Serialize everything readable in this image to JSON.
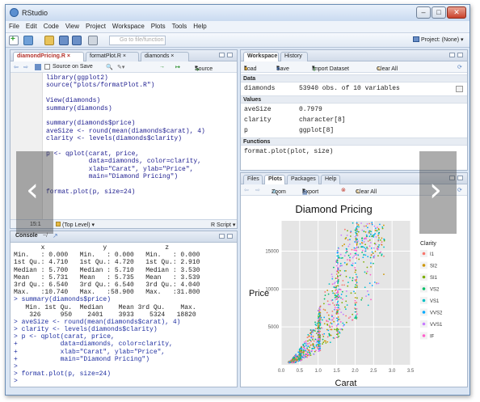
{
  "app": {
    "title": "RStudio"
  },
  "menu": [
    "File",
    "Edit",
    "Code",
    "View",
    "Project",
    "Workspace",
    "Plots",
    "Tools",
    "Help"
  ],
  "toolbar": {
    "go_placeholder": "Go to file/function",
    "project": "Project: (None)"
  },
  "editor": {
    "tabs": [
      "diamondPricing.R",
      "formatPlot.R",
      "diamonds"
    ],
    "source_on_save": "Source on Save",
    "source_btn": "Source",
    "lines": [
      "library(ggplot2)",
      "source(\"plots/formatPlot.R\")",
      "",
      "View(diamonds)",
      "summary(diamonds)",
      "",
      "summary(diamonds$price)",
      "aveSize <- round(mean(diamonds$carat), 4)",
      "clarity <- levels(diamonds$clarity)",
      "",
      "p <- qplot(carat, price,",
      "           data=diamonds, color=clarity,",
      "           xlab=\"Carat\", ylab=\"Price\",",
      "           main=\"Diamond Pricing\")",
      "",
      "format.plot(p, size=24)"
    ],
    "status_pos": "15:1",
    "status_scope": "(Top Level)",
    "status_type": "R Script"
  },
  "console": {
    "title": "Console",
    "path": "~/",
    "lines": [
      {
        "t": "out",
        "s": "       x               y               z        "
      },
      {
        "t": "out",
        "s": "Min.   : 0.000   Min.   : 0.000   Min.   : 0.000"
      },
      {
        "t": "out",
        "s": "1st Qu.: 4.710   1st Qu.: 4.720   1st Qu.: 2.910"
      },
      {
        "t": "out",
        "s": "Median : 5.700   Median : 5.710   Median : 3.530"
      },
      {
        "t": "out",
        "s": "Mean   : 5.731   Mean   : 5.735   Mean   : 3.539"
      },
      {
        "t": "out",
        "s": "3rd Qu.: 6.540   3rd Qu.: 6.540   3rd Qu.: 4.040"
      },
      {
        "t": "out",
        "s": "Max.   :10.740   Max.   :58.900   Max.   :31.800"
      },
      {
        "t": "cmd",
        "s": "> summary(diamonds$price)"
      },
      {
        "t": "out",
        "s": "   Min. 1st Qu.  Median    Mean 3rd Qu.    Max. "
      },
      {
        "t": "out",
        "s": "    326     950    2401    3933    5324   18820 "
      },
      {
        "t": "cmd",
        "s": "> aveSize <- round(mean(diamonds$carat), 4)"
      },
      {
        "t": "cmd",
        "s": "> clarity <- levels(diamonds$clarity)"
      },
      {
        "t": "cmd",
        "s": "> p <- qplot(carat, price,"
      },
      {
        "t": "cmd",
        "s": "+           data=diamonds, color=clarity,"
      },
      {
        "t": "cmd",
        "s": "+           xlab=\"Carat\", ylab=\"Price\","
      },
      {
        "t": "cmd",
        "s": "+           main=\"Diamond Pricing\")"
      },
      {
        "t": "cmd",
        "s": ">"
      },
      {
        "t": "cmd",
        "s": "> format.plot(p, size=24)"
      },
      {
        "t": "cmd",
        "s": ">"
      }
    ]
  },
  "workspace": {
    "tabs": [
      "Workspace",
      "History"
    ],
    "load": "Load",
    "save": "Save",
    "import": "Import Dataset",
    "clear": "Clear All",
    "sections": {
      "data": "Data",
      "values": "Values",
      "functions": "Functions"
    },
    "data_rows": [
      {
        "name": "diamonds",
        "value": "53940 obs. of 10 variables"
      }
    ],
    "value_rows": [
      {
        "name": "aveSize",
        "value": "0.7979"
      },
      {
        "name": "clarity",
        "value": "character[8]"
      },
      {
        "name": "p",
        "value": "ggplot[8]"
      }
    ],
    "function_rows": [
      {
        "name": "format.plot(plot, size)",
        "value": ""
      }
    ]
  },
  "plots": {
    "tabs": [
      "Files",
      "Plots",
      "Packages",
      "Help"
    ],
    "zoom": "Zoom",
    "export": "Export",
    "clear": "Clear All"
  },
  "chart_data": {
    "type": "scatter",
    "title": "Diamond Pricing",
    "xlabel": "Carat",
    "ylabel": "Price",
    "xlim": [
      0,
      3.5
    ],
    "ylim": [
      0,
      19000
    ],
    "xticks": [
      "0.0",
      "0.5",
      "1.0",
      "1.5",
      "2.0",
      "2.5",
      "3.0",
      "3.5"
    ],
    "xtick_values": [
      0,
      0.5,
      1,
      1.5,
      2,
      2.5,
      3,
      3.5
    ],
    "yticks": [
      "5000",
      "10000",
      "15000"
    ],
    "ytick_values": [
      5000,
      10000,
      15000
    ],
    "grid": true,
    "legend_title": "Clarity",
    "legend_position": "right",
    "series": [
      {
        "name": "I1",
        "color": "#f8766d"
      },
      {
        "name": "SI2",
        "color": "#cd9600"
      },
      {
        "name": "SI1",
        "color": "#7cae00"
      },
      {
        "name": "VS2",
        "color": "#00be67"
      },
      {
        "name": "VS1",
        "color": "#00bfc4"
      },
      {
        "name": "VVS2",
        "color": "#00a9ff"
      },
      {
        "name": "VVS1",
        "color": "#c77cff"
      },
      {
        "name": "IF",
        "color": "#ff61cc"
      }
    ]
  },
  "nav": {
    "prev": "‹",
    "next": "›"
  }
}
